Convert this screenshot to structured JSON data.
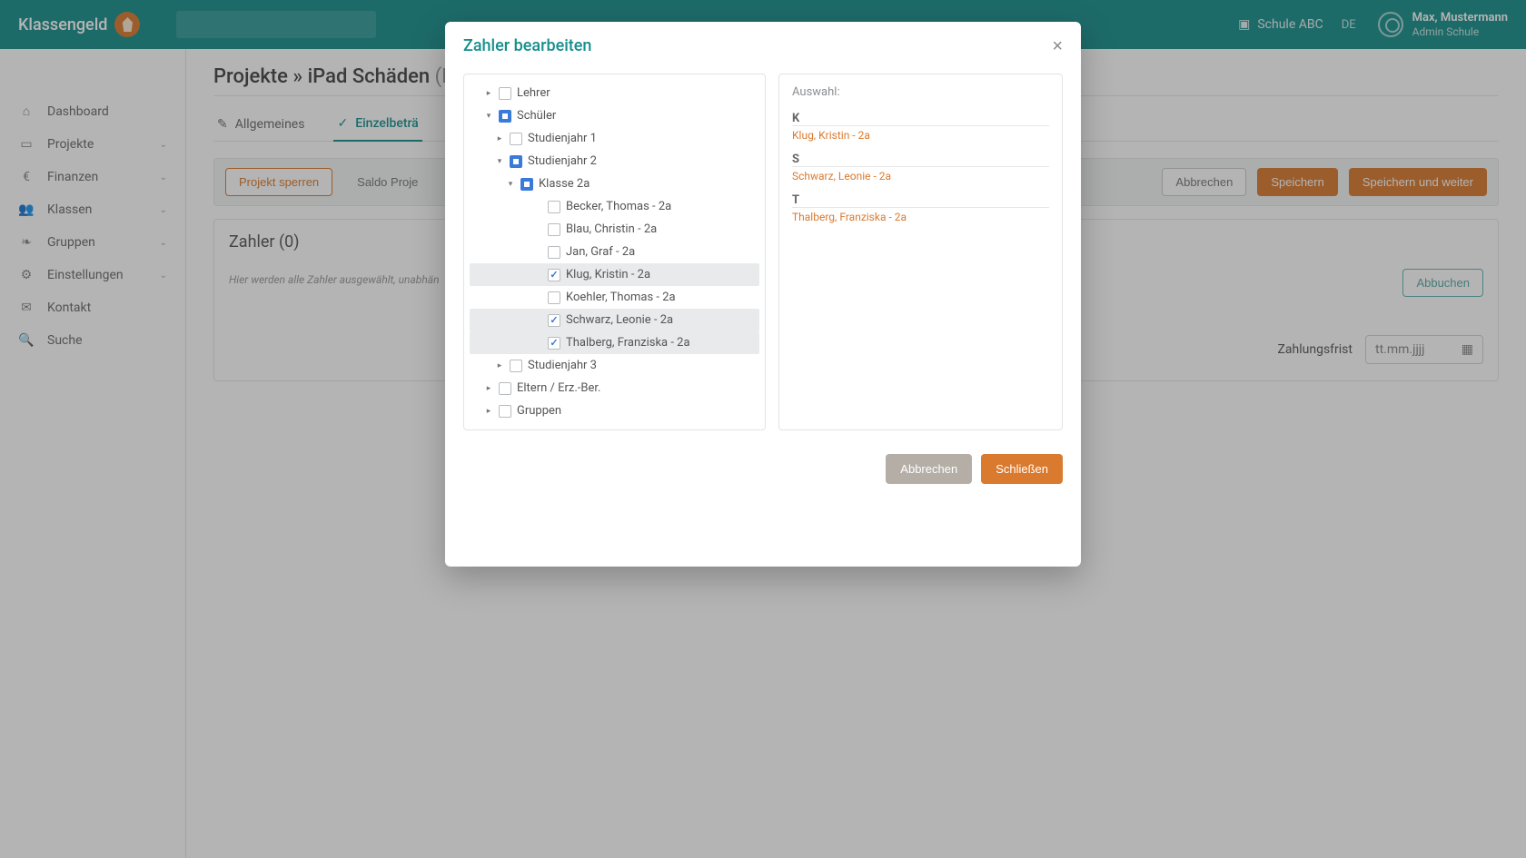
{
  "brand": "Klassengeld",
  "header": {
    "school": "Schule ABC",
    "lang": "DE",
    "user_name": "Max, Mustermann",
    "user_role": "Admin Schule"
  },
  "sidebar": {
    "items": [
      {
        "label": "Dashboard",
        "icon": "home-icon",
        "chev": false
      },
      {
        "label": "Projekte",
        "icon": "card-icon",
        "chev": true
      },
      {
        "label": "Finanzen",
        "icon": "euro-icon",
        "chev": true
      },
      {
        "label": "Klassen",
        "icon": "users-icon",
        "chev": true
      },
      {
        "label": "Gruppen",
        "icon": "leaf-icon",
        "chev": true
      },
      {
        "label": "Einstellungen",
        "icon": "gear-icon",
        "chev": true
      },
      {
        "label": "Kontakt",
        "icon": "mail-icon",
        "chev": false
      },
      {
        "label": "Suche",
        "icon": "search-icon",
        "chev": false
      }
    ]
  },
  "breadcrumb": {
    "root": "Projekte",
    "sep": "»",
    "leaf": "iPad Schäden",
    "extra": "(Ein"
  },
  "tabs": [
    {
      "label": "Allgemeines",
      "icon": "✎",
      "active": false
    },
    {
      "label": "Einzelbeträ",
      "icon": "✓",
      "active": true
    }
  ],
  "actionbar": {
    "lock": "Projekt sperren",
    "saldo": "Saldo Proje",
    "cancel": "Abbrechen",
    "save": "Speichern",
    "save_next": "Speichern und weiter"
  },
  "panel": {
    "title": "Zahler (0)",
    "help": "Hier werden alle Zahler ausgewählt, unabhän",
    "abbuchen": "Abbuchen",
    "zfr_label": "Zahlungsfrist",
    "zfr_placeholder": "tt.mm.jjjj"
  },
  "modal": {
    "title": "Zahler bearbeiten",
    "close": "×",
    "selection_title": "Auswahl:",
    "cancel": "Abbrechen",
    "confirm": "Schließen",
    "tree": [
      {
        "label": "Lehrer",
        "indent": 1,
        "toggle": "▸",
        "state": ""
      },
      {
        "label": "Schüler",
        "indent": 1,
        "toggle": "▾",
        "state": "ind"
      },
      {
        "label": "Studienjahr 1",
        "indent": 2,
        "toggle": "▸",
        "state": ""
      },
      {
        "label": "Studienjahr 2",
        "indent": 2,
        "toggle": "▾",
        "state": "ind"
      },
      {
        "label": "Klasse 2a",
        "indent": 3,
        "toggle": "▾",
        "state": "ind"
      },
      {
        "label": "Becker, Thomas - 2a",
        "indent": 5,
        "toggle": "",
        "state": ""
      },
      {
        "label": "Blau, Christin - 2a",
        "indent": 5,
        "toggle": "",
        "state": ""
      },
      {
        "label": "Jan, Graf - 2a",
        "indent": 5,
        "toggle": "",
        "state": ""
      },
      {
        "label": "Klug, Kristin - 2a",
        "indent": 5,
        "toggle": "",
        "state": "chk",
        "selected": true
      },
      {
        "label": "Koehler, Thomas - 2a",
        "indent": 5,
        "toggle": "",
        "state": ""
      },
      {
        "label": "Schwarz, Leonie - 2a",
        "indent": 5,
        "toggle": "",
        "state": "chk",
        "selected": true
      },
      {
        "label": "Thalberg, Franziska - 2a",
        "indent": 5,
        "toggle": "",
        "state": "chk",
        "selected": true
      },
      {
        "label": "Studienjahr 3",
        "indent": 2,
        "toggle": "▸",
        "state": ""
      },
      {
        "label": "Eltern / Erz.-Ber.",
        "indent": 1,
        "toggle": "▸",
        "state": ""
      },
      {
        "label": "Gruppen",
        "indent": 1,
        "toggle": "▸",
        "state": ""
      }
    ],
    "selection_groups": [
      {
        "letter": "K",
        "items": [
          "Klug, Kristin - 2a"
        ]
      },
      {
        "letter": "S",
        "items": [
          "Schwarz, Leonie - 2a"
        ]
      },
      {
        "letter": "T",
        "items": [
          "Thalberg, Franziska - 2a"
        ]
      }
    ]
  }
}
